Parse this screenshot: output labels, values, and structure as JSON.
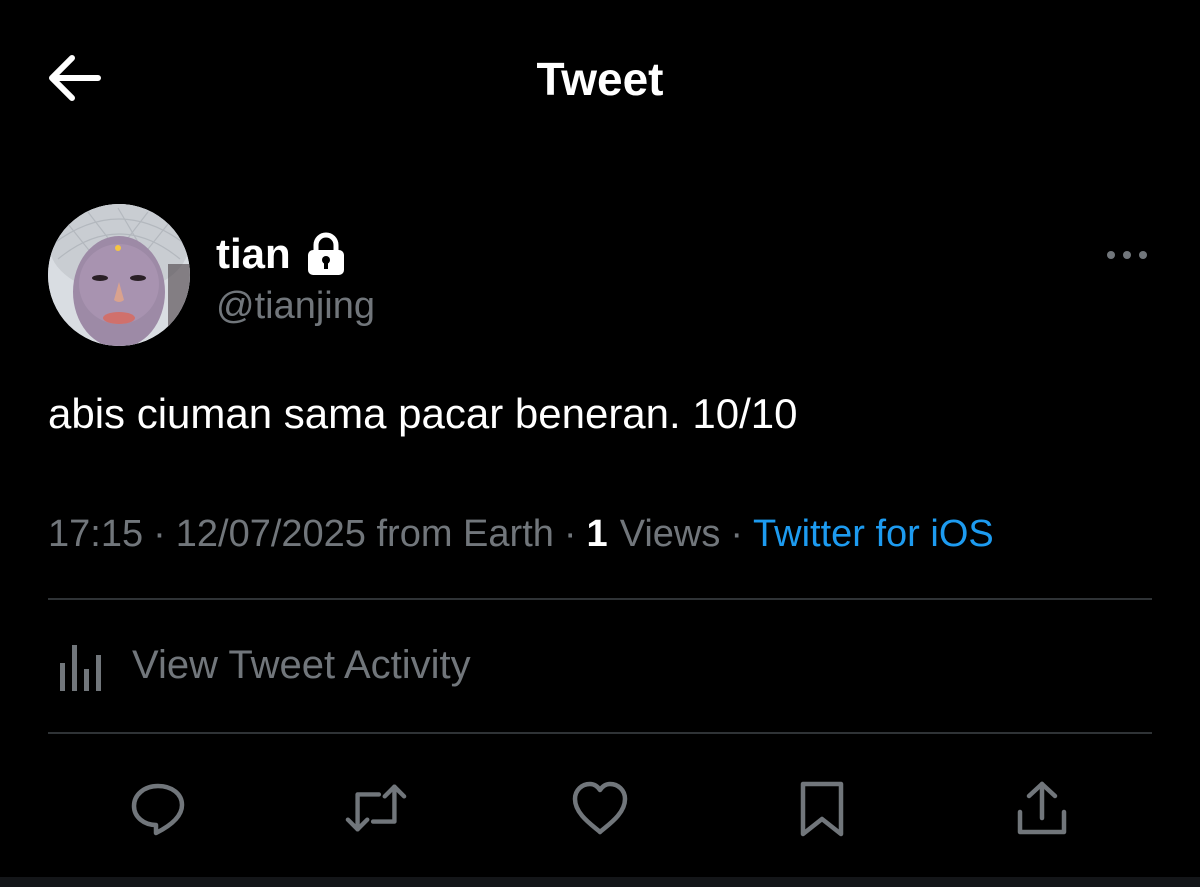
{
  "header": {
    "title": "Tweet",
    "back_icon": "arrow-left-icon"
  },
  "author": {
    "display_name": "tian",
    "handle": "@tianjing",
    "protected_icon": "lock-icon",
    "more_icon": "ellipsis-icon"
  },
  "tweet": {
    "text": "abis ciuman sama pacar beneran. 10/10"
  },
  "meta": {
    "time": "17:15",
    "separator": "·",
    "date": "12/07/2025",
    "location": "from Earth",
    "views_count": "1",
    "views_label": "Views",
    "source": "Twitter for iOS"
  },
  "activity": {
    "label": "View Tweet Activity",
    "icon": "bar-chart-icon"
  },
  "actions": [
    {
      "name": "reply",
      "icon": "speech-bubble-icon"
    },
    {
      "name": "retweet",
      "icon": "retweet-icon"
    },
    {
      "name": "like",
      "icon": "heart-icon"
    },
    {
      "name": "bookmark",
      "icon": "bookmark-icon"
    },
    {
      "name": "share",
      "icon": "share-icon"
    }
  ],
  "colors": {
    "background": "#000000",
    "primary_text": "#ffffff",
    "secondary_text": "#71767b",
    "link": "#1d9bf0",
    "divider": "#2f3336"
  }
}
